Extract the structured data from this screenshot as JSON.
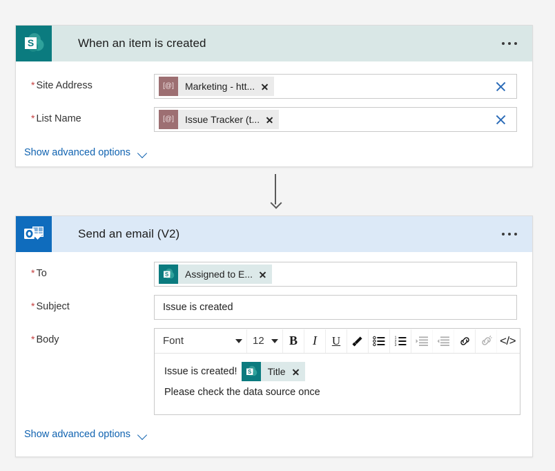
{
  "canvas": {
    "background_color": "#f4f4f4"
  },
  "trigger_card": {
    "icon": "sharepoint-icon",
    "header_color": "#d9e7e6",
    "icon_color": "#0b7b7f",
    "title": "When an item is created",
    "menu": "ellipsis-menu",
    "fields": [
      {
        "label": "Site Address",
        "required": true,
        "token": {
          "badge": "at-symbol-badge",
          "badge_text": "[@]",
          "badge_color": "#9d6f72",
          "text": "Marketing - htt...",
          "remove": "x"
        },
        "clear": "clear-field"
      },
      {
        "label": "List Name",
        "required": true,
        "token": {
          "badge": "at-symbol-badge",
          "badge_text": "[@]",
          "badge_color": "#9d6f72",
          "text": "Issue Tracker (t...",
          "remove": "x"
        },
        "clear": "clear-field"
      }
    ],
    "advanced_link": "Show advanced options"
  },
  "connector": {
    "shape": "down-arrow"
  },
  "action_card": {
    "icon": "outlook-icon",
    "header_color": "#dce9f7",
    "icon_color": "#0f6cbd",
    "title": "Send an email (V2)",
    "menu": "ellipsis-menu",
    "to_field": {
      "label": "To",
      "required": true,
      "token": {
        "badge": "sharepoint-badge",
        "badge_color": "#0b7b7f",
        "text": "Assigned to E...",
        "remove": "x"
      }
    },
    "subject_field": {
      "label": "Subject",
      "required": true,
      "value": "Issue is created"
    },
    "body_field": {
      "label": "Body",
      "required": true,
      "toolbar": {
        "font_name": "Font",
        "font_size": "12",
        "bold": "B",
        "italic": "I",
        "underline": "U",
        "highlight": "highlighter-icon",
        "bulleted_list": "bulleted-list-icon",
        "numbered_list": "numbered-list-icon",
        "indent": "indent-icon",
        "outdent": "outdent-icon",
        "link": "link-icon",
        "unlink": "unlink-icon",
        "code_view": "</>"
      },
      "content": {
        "line1_text": "Issue is created!",
        "line1_token": {
          "badge": "sharepoint-badge",
          "badge_color": "#0b7b7f",
          "text": "Title",
          "remove": "x"
        },
        "line2_text": "Please check the data source once"
      }
    },
    "advanced_link": "Show advanced options"
  }
}
